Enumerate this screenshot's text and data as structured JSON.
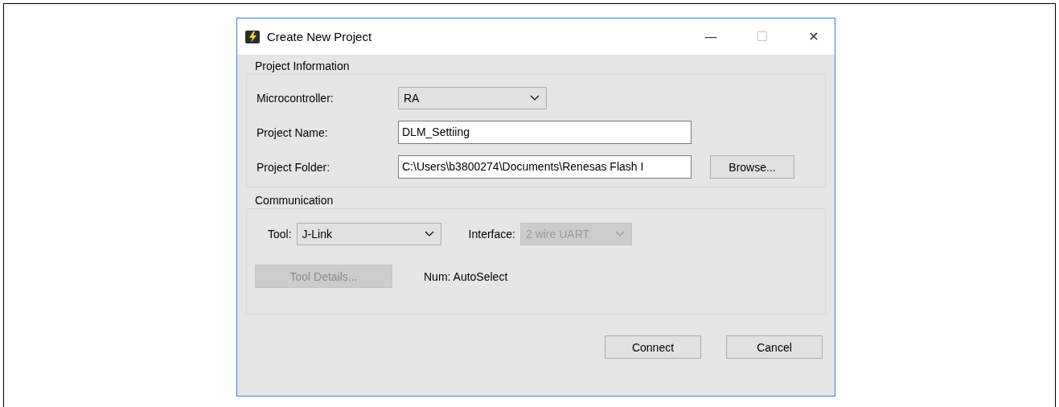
{
  "window": {
    "title": "Create New Project",
    "controls": [
      "—",
      "☐",
      "✕"
    ]
  },
  "project_information": {
    "title": "Project Information",
    "rows": [
      {
        "label": "Microcontroller:",
        "kind": "combo",
        "value": "RA",
        "disabled": false
      },
      {
        "label": "Project Name:",
        "kind": "text",
        "value": "DLM_Settiing"
      },
      {
        "label": "Project Folder:",
        "kind": "text",
        "value": "C:\\Users\\b3800274\\Documents\\Renesas Flash I",
        "button": "Browse..."
      }
    ]
  },
  "communication": {
    "title": "Communication",
    "tool": {
      "label": "Tool:",
      "value": "J-Link",
      "disabled": false
    },
    "interface": {
      "label": "Interface:",
      "value": "2 wire UART",
      "disabled": true
    },
    "tool_details": {
      "label": "Tool Details...",
      "disabled": true
    },
    "num": "Num: AutoSelect"
  },
  "buttons": [
    {
      "label": "Connect",
      "disabled": false
    },
    {
      "label": "Cancel",
      "disabled": false
    }
  ]
}
